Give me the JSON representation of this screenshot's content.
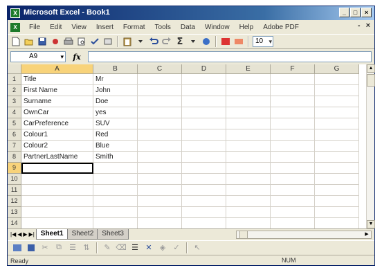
{
  "window": {
    "title": "Microsoft Excel - Book1",
    "app_icon_glyph": "X",
    "controls": [
      "_",
      "□",
      "×"
    ]
  },
  "menubar": {
    "doc_icon_glyph": "X",
    "items": [
      "File",
      "Edit",
      "View",
      "Insert",
      "Format",
      "Tools",
      "Data",
      "Window",
      "Help",
      "Adobe PDF"
    ],
    "right_controls": [
      "-",
      "×"
    ]
  },
  "toolbar": {
    "font_size_value": "10"
  },
  "formula_bar": {
    "name_box": "A9",
    "fx": "fx",
    "formula": ""
  },
  "grid": {
    "columns": [
      "A",
      "B",
      "C",
      "D",
      "E",
      "F",
      "G"
    ],
    "active_column": "A",
    "active_row": "9",
    "rows": [
      {
        "num": "1",
        "a": "Title",
        "b": "Mr"
      },
      {
        "num": "2",
        "a": "First Name",
        "b": "John"
      },
      {
        "num": "3",
        "a": "Surname",
        "b": "Doe"
      },
      {
        "num": "4",
        "a": "OwnCar",
        "b": "yes"
      },
      {
        "num": "5",
        "a": "CarPreference",
        "b": "SUV"
      },
      {
        "num": "6",
        "a": "Colour1",
        "b": "Red"
      },
      {
        "num": "7",
        "a": "Colour2",
        "b": "Blue"
      },
      {
        "num": "8",
        "a": "PartnerLastName",
        "b": "Smith"
      },
      {
        "num": "9",
        "a": "",
        "b": ""
      },
      {
        "num": "10",
        "a": "",
        "b": ""
      },
      {
        "num": "11",
        "a": "",
        "b": ""
      },
      {
        "num": "12",
        "a": "",
        "b": ""
      },
      {
        "num": "13",
        "a": "",
        "b": ""
      },
      {
        "num": "14",
        "a": "",
        "b": ""
      }
    ]
  },
  "sheets": {
    "tabs": [
      "Sheet1",
      "Sheet2",
      "Sheet3"
    ],
    "active": "Sheet1"
  },
  "status": {
    "left": "Ready",
    "indicator": "NUM"
  }
}
